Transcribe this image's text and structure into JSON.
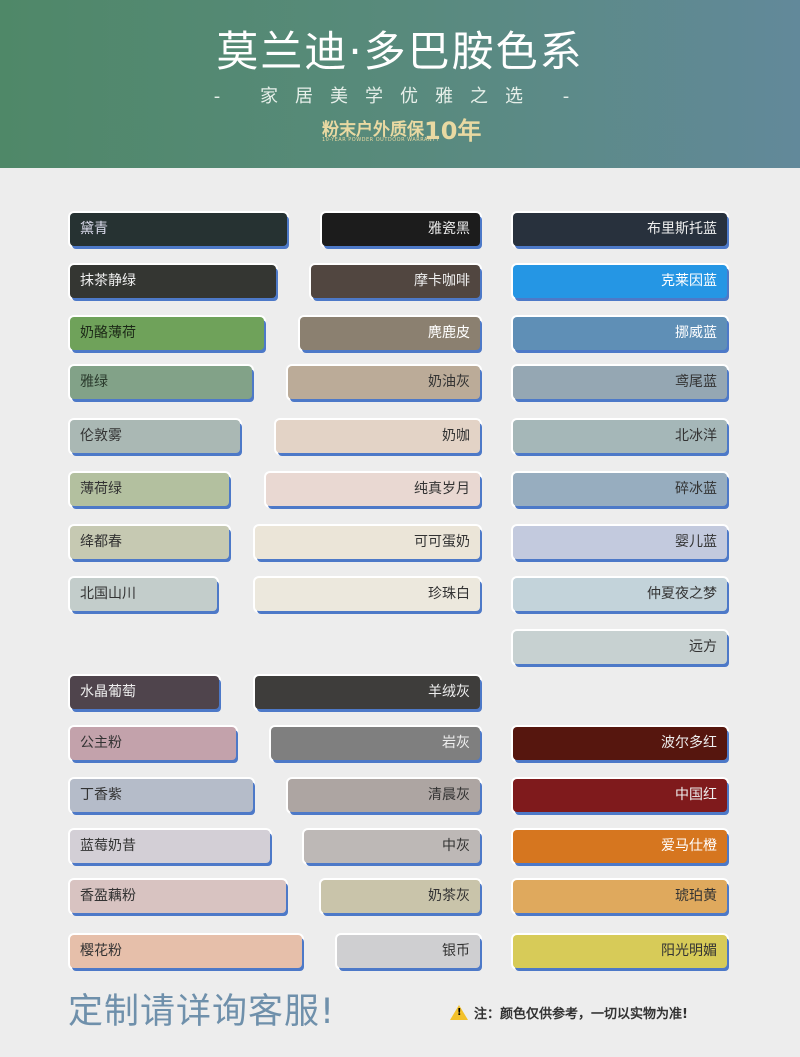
{
  "header": {
    "title": "莫兰迪·多巴胺色系",
    "subtitle": "- 家居美学优雅之选 -",
    "badge_text": "粉末户外质保",
    "badge_years": "10年",
    "badge_english": "10-YEAR POWDER OUTDOOR WARRANTY"
  },
  "swatches": [
    {
      "name": "黛青",
      "color": "#263232",
      "text": "#dde",
      "col": 1
    },
    {
      "name": "抹茶静绿",
      "color": "#343632",
      "text": "#eee",
      "col": 1
    },
    {
      "name": "奶酪薄荷",
      "color": "#6fa25a",
      "text": "#1d2a18",
      "col": 1
    },
    {
      "name": "雅绿",
      "color": "#82a288",
      "text": "#2a3a2c",
      "col": 1
    },
    {
      "name": "伦敦雾",
      "color": "#aab8b4",
      "text": "#333",
      "col": 1
    },
    {
      "name": "薄荷绿",
      "color": "#b3c09f",
      "text": "#333",
      "col": 1
    },
    {
      "name": "绛都春",
      "color": "#c6c9b2",
      "text": "#333",
      "col": 1
    },
    {
      "name": "北国山川",
      "color": "#c3cdcb",
      "text": "#333",
      "col": 1
    },
    {
      "name": "水晶葡萄",
      "color": "#4f444c",
      "text": "#eee",
      "col": 1
    },
    {
      "name": "公主粉",
      "color": "#c3a2ab",
      "text": "#333",
      "col": 1
    },
    {
      "name": "丁香紫",
      "color": "#b5bcc9",
      "text": "#333",
      "col": 1
    },
    {
      "name": "蓝莓奶昔",
      "color": "#d3cfd6",
      "text": "#333",
      "col": 1
    },
    {
      "name": "香盈藕粉",
      "color": "#d8c3c1",
      "text": "#333",
      "col": 1
    },
    {
      "name": "樱花粉",
      "color": "#e6bfaa",
      "text": "#333",
      "col": 1
    },
    {
      "name": "雅瓷黑",
      "color": "#1c1c1c",
      "text": "#eee",
      "col": 2
    },
    {
      "name": "摩卡咖啡",
      "color": "#514640",
      "text": "#eee",
      "col": 2
    },
    {
      "name": "麂鹿皮",
      "color": "#8b8070",
      "text": "#fff",
      "col": 2
    },
    {
      "name": "奶油灰",
      "color": "#bbab98",
      "text": "#333",
      "col": 2
    },
    {
      "name": "奶咖",
      "color": "#e3d3c6",
      "text": "#333",
      "col": 2
    },
    {
      "name": "纯真岁月",
      "color": "#e9d8d2",
      "text": "#333",
      "col": 2
    },
    {
      "name": "可可蛋奶",
      "color": "#ebe5d8",
      "text": "#333",
      "col": 2
    },
    {
      "name": "珍珠白",
      "color": "#ece8dd",
      "text": "#333",
      "col": 2
    },
    {
      "name": "羊绒灰",
      "color": "#3e3d3b",
      "text": "#eee",
      "col": 2
    },
    {
      "name": "岩灰",
      "color": "#7f7f7f",
      "text": "#eee",
      "col": 2
    },
    {
      "name": "清晨灰",
      "color": "#ada5a2",
      "text": "#333",
      "col": 2
    },
    {
      "name": "中灰",
      "color": "#bdb8b6",
      "text": "#333",
      "col": 2
    },
    {
      "name": "奶茶灰",
      "color": "#c9c4aa",
      "text": "#333",
      "col": 2
    },
    {
      "name": "银币",
      "color": "#cfcfd1",
      "text": "#333",
      "col": 2
    },
    {
      "name": "布里斯托蓝",
      "color": "#28313d",
      "text": "#eee",
      "col": 3
    },
    {
      "name": "克莱因蓝",
      "color": "#2596e4",
      "text": "#fff",
      "col": 3
    },
    {
      "name": "挪威蓝",
      "color": "#5f8fb6",
      "text": "#fff",
      "col": 3
    },
    {
      "name": "鸢尾蓝",
      "color": "#95a7b3",
      "text": "#333",
      "col": 3
    },
    {
      "name": "北冰洋",
      "color": "#a5b7b8",
      "text": "#333",
      "col": 3
    },
    {
      "name": "碎冰蓝",
      "color": "#97adbf",
      "text": "#333",
      "col": 3
    },
    {
      "name": "婴儿蓝",
      "color": "#c3cade",
      "text": "#333",
      "col": 3
    },
    {
      "name": "仲夏夜之梦",
      "color": "#c3d3da",
      "text": "#333",
      "col": 3
    },
    {
      "name": "远方",
      "color": "#c7d1d1",
      "text": "#333",
      "col": 3
    },
    {
      "name": "波尔多红",
      "color": "#56160e",
      "text": "#eee",
      "col": 3
    },
    {
      "name": "中国红",
      "color": "#7f1a1c",
      "text": "#eee",
      "col": 3
    },
    {
      "name": "爱马仕橙",
      "color": "#d6761f",
      "text": "#fff",
      "col": 3
    },
    {
      "name": "琥珀黄",
      "color": "#dfa95d",
      "text": "#333",
      "col": 3
    },
    {
      "name": "阳光明媚",
      "color": "#d7cb58",
      "text": "#333",
      "col": 3
    }
  ],
  "footer": {
    "contact": "定制请详询客服!",
    "note": "注：颜色仅供参考，一切以实物为准!"
  }
}
